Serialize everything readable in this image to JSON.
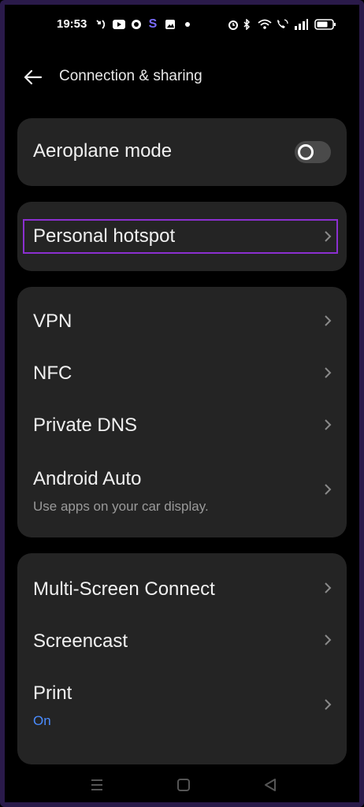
{
  "status": {
    "time": "19:53",
    "left_icons": [
      "missed-call-icon",
      "youtube-icon",
      "whatsapp-icon",
      "s-app-icon",
      "gallery-icon",
      "dot-icon"
    ],
    "right_icons": [
      "alarm-icon",
      "bluetooth-icon",
      "wifi-icon",
      "wifi-call-icon",
      "signal-icon",
      "battery-icon"
    ]
  },
  "header": {
    "title": "Connection & sharing",
    "back_icon": "back-arrow-icon"
  },
  "cards": {
    "aeroplane": {
      "label": "Aeroplane mode",
      "toggle_on": false
    },
    "hotspot": {
      "label": "Personal hotspot"
    },
    "network": {
      "vpn": "VPN",
      "nfc": "NFC",
      "private_dns": "Private DNS",
      "android_auto": "Android Auto",
      "android_auto_sub": "Use apps on your car display."
    },
    "screen": {
      "multi_screen": "Multi-Screen Connect",
      "screencast": "Screencast",
      "print": "Print",
      "print_sub": "On"
    }
  },
  "colors": {
    "background": "#000000",
    "card": "#242424",
    "accent": "#4a8cff",
    "focus": "#8b2fd0"
  },
  "navbar": {
    "icons": [
      "menu-icon",
      "home-icon",
      "back-triangle-icon"
    ]
  }
}
